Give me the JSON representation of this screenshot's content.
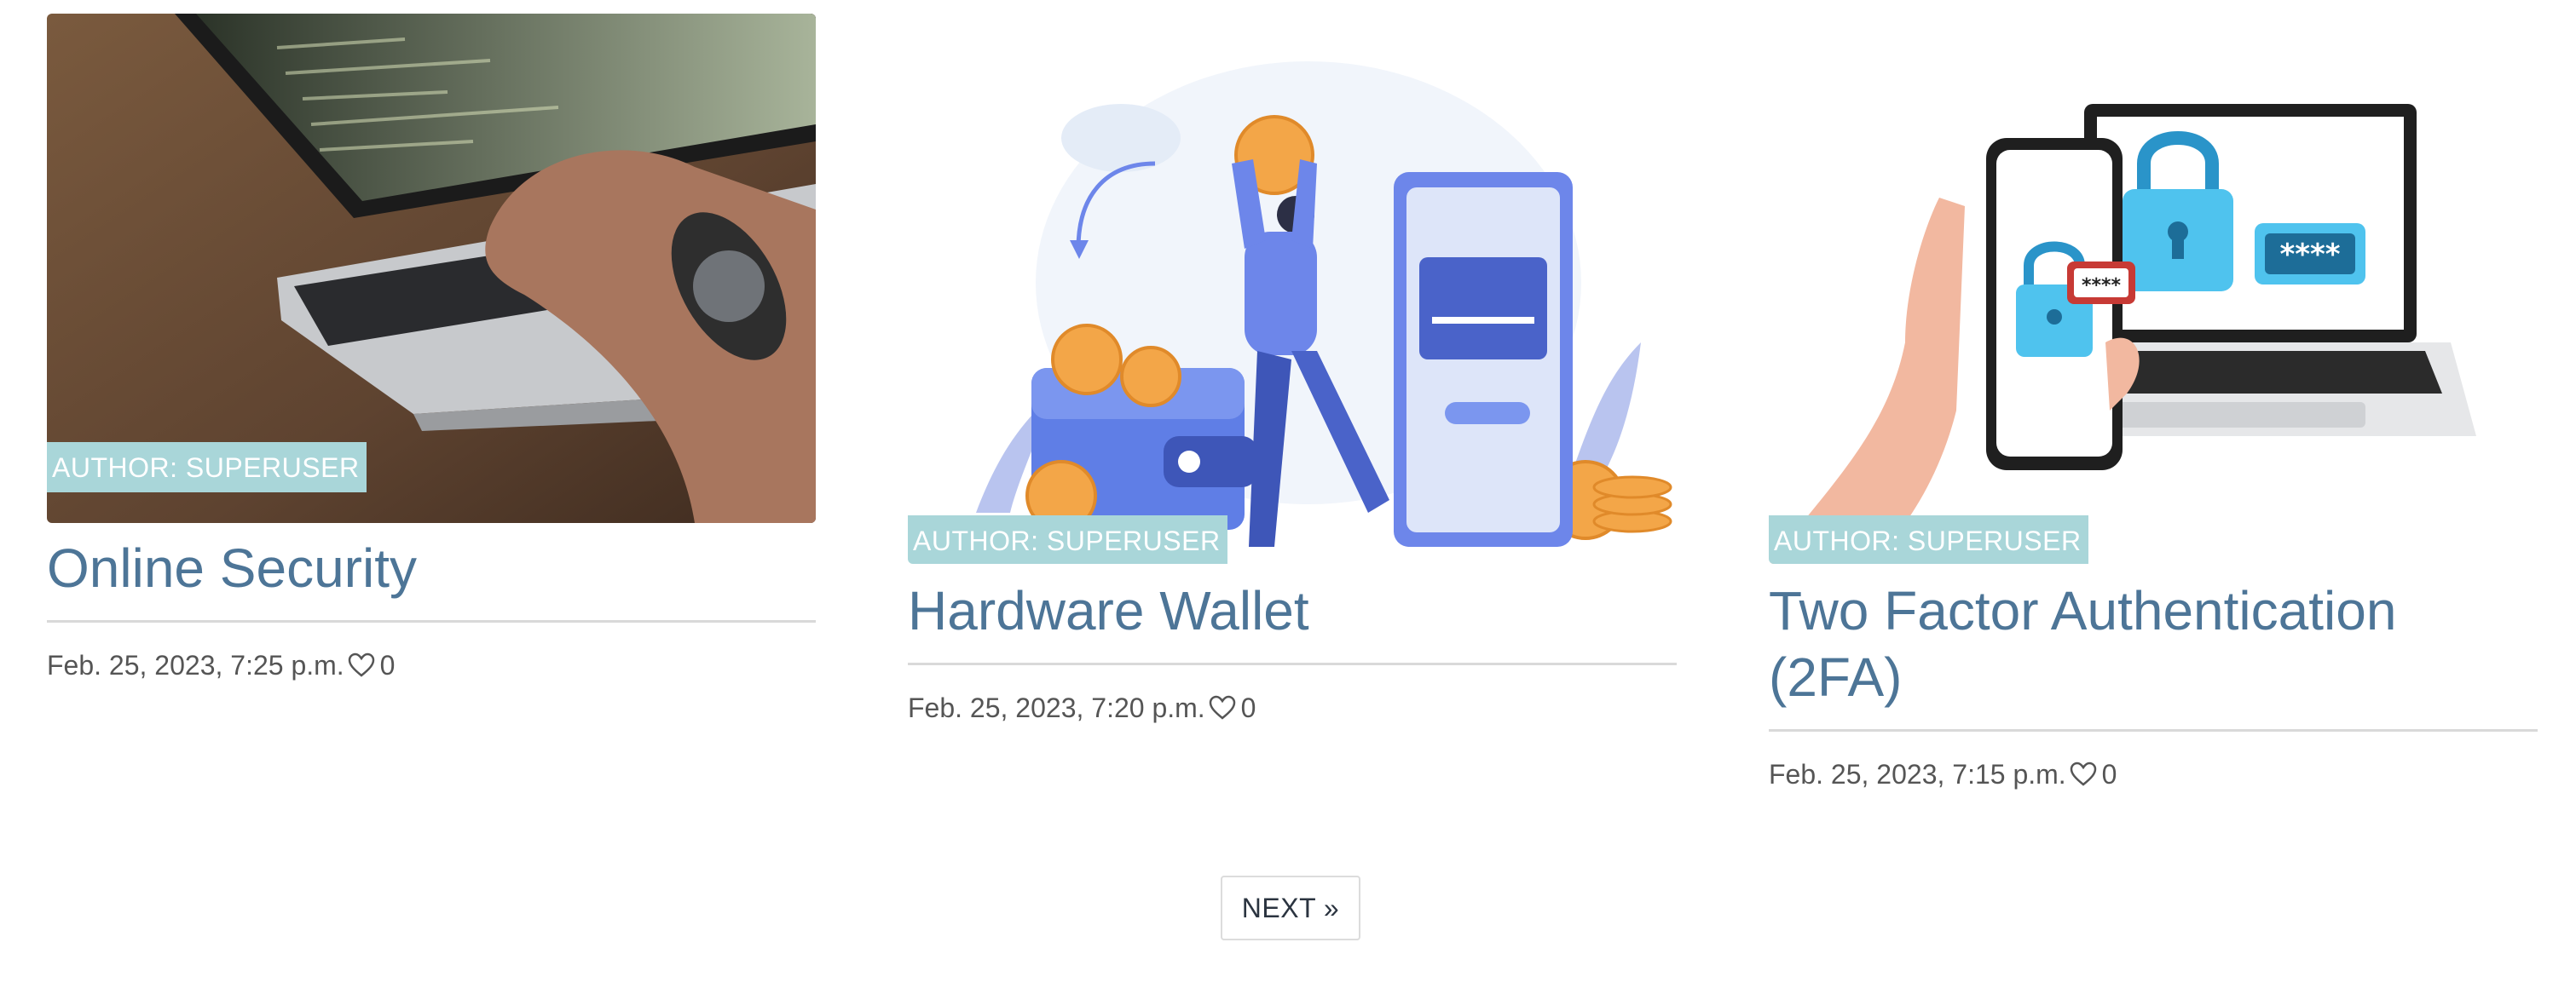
{
  "posts": [
    {
      "author_badge": "AUTHOR: SUPERUSER",
      "title": "Online Security",
      "date": "Feb. 25, 2023, 7:25 p.m.",
      "likes": "0",
      "image_icon": "laptop-typing-photo"
    },
    {
      "author_badge": "AUTHOR: SUPERUSER",
      "title": "Hardware Wallet",
      "date": "Feb. 25, 2023, 7:20 p.m.",
      "likes": "0",
      "image_icon": "hardware-wallet-illustration"
    },
    {
      "author_badge": "AUTHOR: SUPERUSER",
      "title": "Two Factor Authentication (2FA)",
      "date": "Feb. 25, 2023, 7:15 p.m.",
      "likes": "0",
      "image_icon": "two-factor-illustration"
    }
  ],
  "pagination": {
    "next_label": "NEXT »"
  },
  "colors": {
    "title": "#4d7597",
    "badge_bg": "#a9d6d9",
    "divider": "#d9d9d9",
    "meta_text": "#555555"
  }
}
